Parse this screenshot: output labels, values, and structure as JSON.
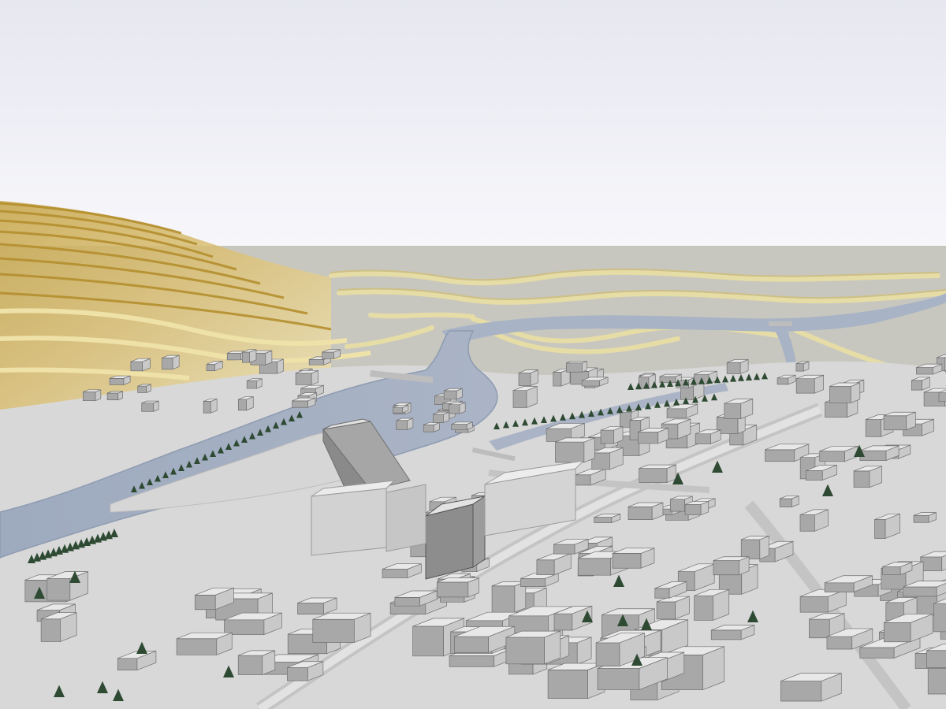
{
  "scene": {
    "kind": "3D city model render",
    "colors": {
      "sky_top": "#e7e8f1",
      "sky_bottom": "#f6f6fa",
      "ground": "#c9c8c0",
      "city_ground": "#d9d9d9",
      "river": "#a4afc2",
      "river_edge": "#8e9bb1",
      "hill_gold": "#c9aa4a",
      "hill_light": "#ecdca0",
      "contour": "#d9cc91",
      "building_roof": "#e7e7e7",
      "building_side": "#a9a9a9",
      "building_dark": "#8f8f8f",
      "tree": "#2f4f35"
    }
  }
}
